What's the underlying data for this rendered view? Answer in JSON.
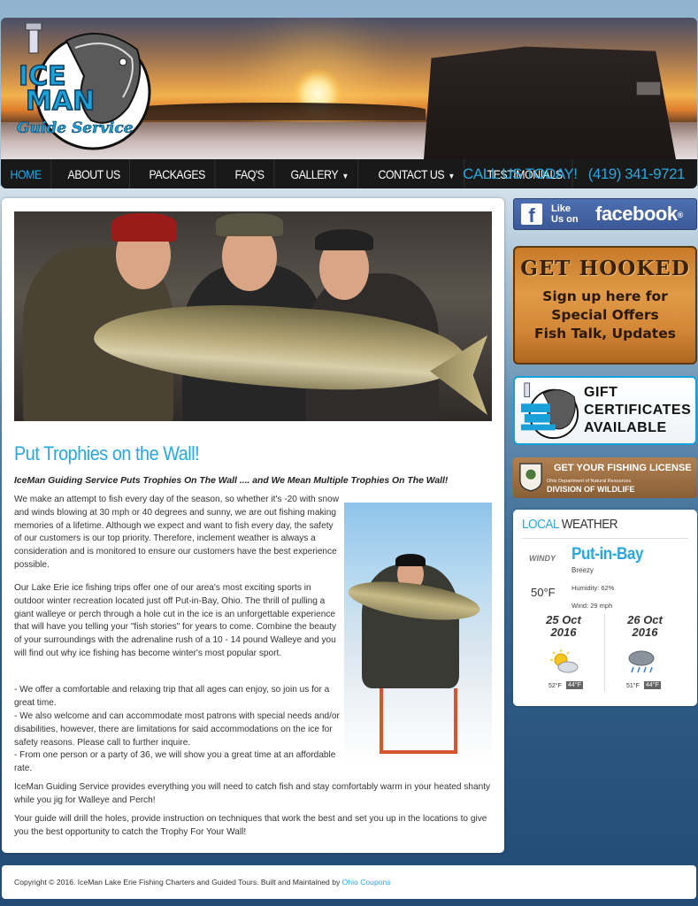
{
  "logo": {
    "line1": "ICE",
    "line2": "MAN",
    "line3": "Guide Service"
  },
  "nav": {
    "items": [
      {
        "label": "HOME",
        "active": true
      },
      {
        "label": "ABOUT US"
      },
      {
        "label": "PACKAGES"
      },
      {
        "label": "FAQ'S"
      },
      {
        "label": "GALLERY",
        "dropdown": true
      },
      {
        "label": "CONTACT US",
        "dropdown": true
      },
      {
        "label": "TESTIMONIALS"
      }
    ],
    "call_label": "CALL US TODAY!",
    "phone": "(419) 341-9721"
  },
  "main": {
    "title": "Put Trophies on the Wall!",
    "tagline": "IceMan Guiding Service Puts Trophies On The Wall .... and We Mean Multiple Trophies On The Wall!",
    "paragraphs": [
      "We make an attempt to fish every day of the season, so whether it's -20 with snow and winds blowing at 30 mph or 40 degrees and sunny, we are out fishing making memories of a lifetime. Although we expect and want to fish every day, the safety of our customers is our top priority. Therefore, inclement weather is always a consideration and is monitored to ensure our customers have the best experience possible.",
      "Our Lake Erie ice fishing trips offer one of our area's most exciting sports in outdoor winter recreation located just off Put-in-Bay, Ohio.  The thrill of pulling a giant walleye or perch through a hole cut in the ice is an unforgettable experience that will have you telling your \"fish stories\" for years to come. Combine the beauty of your surroundings with the adrenaline rush of a 10 - 14 pound Walleye and you will find out why ice fishing has become winter's most popular sport.",
      "- We offer a comfortable and relaxing trip that all ages can enjoy, so join us for a great time.",
      "- We also welcome and can accommodate most patrons with special needs and/or disabilities, however, there are limitations for said accommodations on the ice for safety reasons.  Please call to further inquire.",
      "- From one person or a party of 36, we will show you a great time at an affordable rate.",
      "IceMan Guiding Service provides everything you will need to catch fish and stay comfortably warm in your heated shanty while you jig for Walleye and Perch!",
      "Your guide will drill the holes, provide instruction on techniques that work the best and set you up in the locations to give you the best opportunity to catch the Trophy For Your Wall!"
    ]
  },
  "sidebar": {
    "facebook": {
      "like": "Like",
      "us_on": "Us on",
      "word": "facebook",
      "mark": "®"
    },
    "hooked": {
      "title": "GET HOOKED",
      "line1": "Sign up here for",
      "line2": "Special Offers",
      "line3": "Fish Talk, Updates"
    },
    "gift": {
      "line1": "GIFT",
      "line2": "CERTIFICATES",
      "line3": "AVAILABLE"
    },
    "license": {
      "title": "GET YOUR FISHING LICENSE",
      "sub": "Ohio Department of Natural Resources",
      "sub2": "DIVISION OF WILDLIFE"
    },
    "weather": {
      "head_local": "LOCAL",
      "head_word": "WEATHER",
      "city": "Put-in-Bay",
      "condition": "Breezy",
      "icon_label": "WINDY",
      "temp": "50°F",
      "humidity": "Humidity: 62%",
      "wind": "Wind: 29 mph",
      "forecast": [
        {
          "date_line1": "25 Oct",
          "date_line2": "2016",
          "hi": "52°F",
          "lo": "44°F",
          "icon": "partly-sunny-icon"
        },
        {
          "date_line1": "26 Oct",
          "date_line2": "2016",
          "hi": "51°F",
          "lo": "44°F",
          "icon": "rain-cloud-icon"
        }
      ]
    }
  },
  "footer": {
    "text": "Copyright © 2016. IceMan Lake Erie Fishing Charters and Guided Tours. Built and Maintained by ",
    "link": "Ohio Coupons"
  },
  "colors": {
    "accent": "#2aa7e0",
    "nav_bg": "#191919",
    "facebook": "#3b5998"
  }
}
